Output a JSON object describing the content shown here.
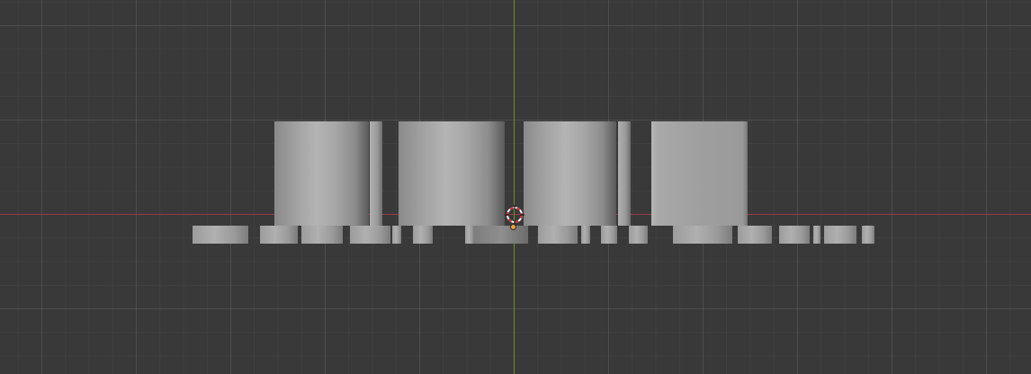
{
  "viewport": {
    "background_color": "#393939",
    "axis_colors": {
      "x": "#9a3b45",
      "y": "#6d8f25"
    }
  },
  "scene": {
    "objects": [
      "cylinder",
      "cylinder",
      "cylinder",
      "cube"
    ],
    "base_plate": "segmented-base"
  },
  "icons": {
    "cursor": "3d-cursor-icon",
    "origin": "origin-point-icon"
  }
}
